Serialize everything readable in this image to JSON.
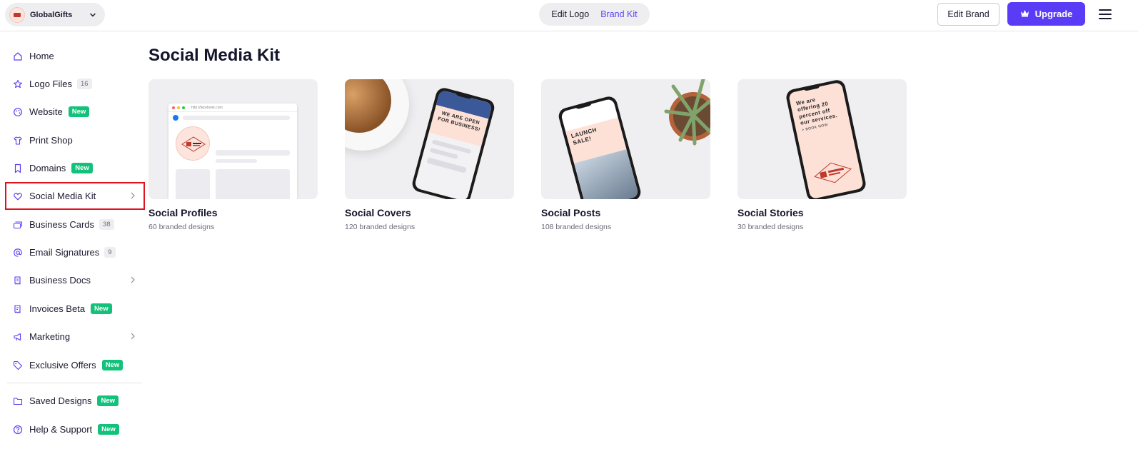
{
  "header": {
    "brand_name": "GlobalGifts",
    "tabs": [
      {
        "label": "Edit Logo",
        "active": false
      },
      {
        "label": "Brand Kit",
        "active": true
      }
    ],
    "edit_brand_label": "Edit Brand",
    "upgrade_label": "Upgrade",
    "accent_color": "#5a3cf6"
  },
  "sidebar": {
    "items": [
      {
        "label": "Home",
        "icon": "home-icon"
      },
      {
        "label": "Logo Files",
        "icon": "star-icon",
        "count": "16"
      },
      {
        "label": "Website",
        "icon": "palette-icon",
        "badge": "New"
      },
      {
        "label": "Print Shop",
        "icon": "shirt-icon"
      },
      {
        "label": "Domains",
        "icon": "bookmark-icon",
        "badge": "New"
      },
      {
        "label": "Social Media Kit",
        "icon": "heart-icon",
        "selected": true
      },
      {
        "label": "Business Cards",
        "icon": "cards-icon",
        "count": "38"
      },
      {
        "label": "Email Signatures",
        "icon": "at-icon",
        "count": "9"
      },
      {
        "label": "Business Docs",
        "icon": "document-icon"
      },
      {
        "label": "Invoices Beta",
        "icon": "invoice-icon",
        "badge": "New"
      },
      {
        "label": "Marketing",
        "icon": "megaphone-icon"
      },
      {
        "label": "Exclusive Offers",
        "icon": "tag-icon",
        "badge": "New"
      },
      {
        "label": "Saved Designs",
        "icon": "folder-icon",
        "badge": "New"
      },
      {
        "label": "Help & Support",
        "icon": "help-icon",
        "badge": "New"
      }
    ]
  },
  "main": {
    "title": "Social Media Kit",
    "cards": [
      {
        "title": "Social Profiles",
        "subtitle": "60 branded designs",
        "url_text": "http://facebook.com"
      },
      {
        "title": "Social Covers",
        "subtitle": "120 branded designs",
        "phone_text": "WE ARE OPEN FOR BUSINESS!"
      },
      {
        "title": "Social Posts",
        "subtitle": "108 branded designs",
        "phone_text": "LAUNCH SALE!"
      },
      {
        "title": "Social Stories",
        "subtitle": "30 branded designs",
        "phone_text": "We are offering 20 percent off our services.",
        "phone_cta": "> BOOK NOW"
      }
    ]
  }
}
